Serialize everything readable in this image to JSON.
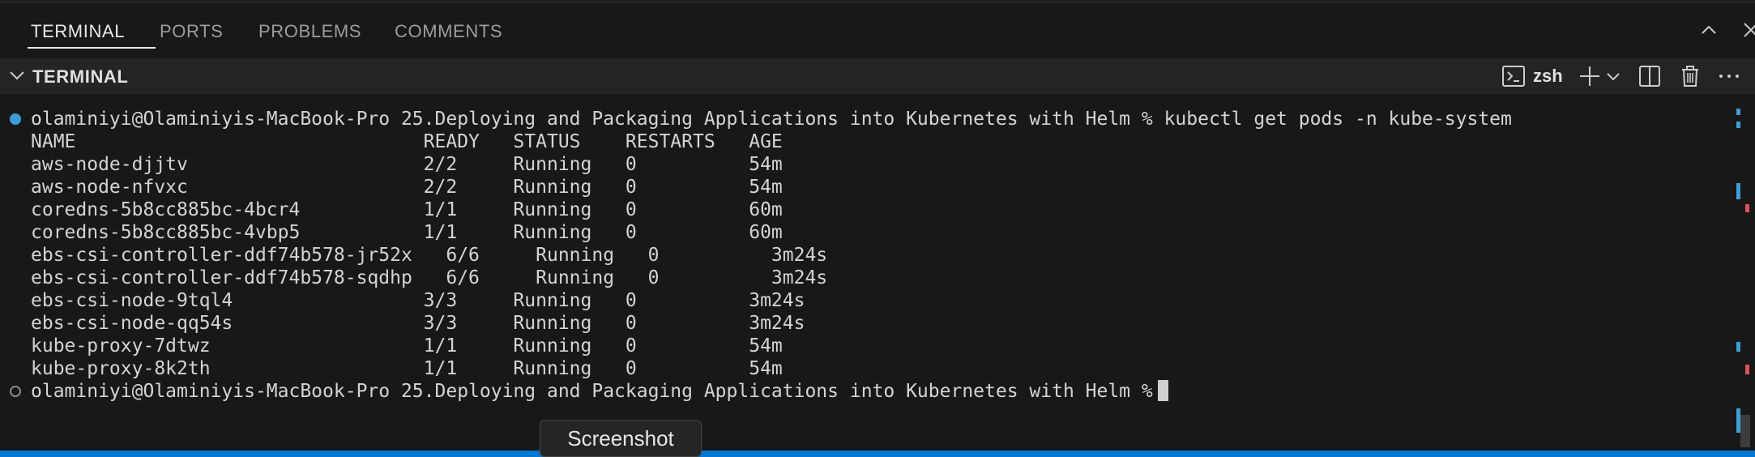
{
  "panel": {
    "tabs": [
      {
        "label": "TERMINAL"
      },
      {
        "label": "PORTS"
      },
      {
        "label": "PROBLEMS"
      },
      {
        "label": "COMMENTS"
      }
    ],
    "active_tab": "TERMINAL",
    "controls": [
      "chevron-up-icon",
      "close-icon"
    ]
  },
  "terminal_header": {
    "title": "TERMINAL",
    "shell": "zsh",
    "icons": [
      "terminal-icon",
      "plus-icon",
      "chevron-down-icon",
      "split-icon",
      "trash-icon",
      "more-icon"
    ]
  },
  "terminal": {
    "command_line": "olaminiyi@Olaminiyis-MacBook-Pro 25.Deploying and Packaging Applications into Kubernetes with Helm % kubectl get pods -n kube-system",
    "lines": [
      "NAME                               READY   STATUS    RESTARTS   AGE",
      "aws-node-djjtv                     2/2     Running   0          54m",
      "aws-node-nfvxc                     2/2     Running   0          54m",
      "coredns-5b8cc885bc-4bcr4           1/1     Running   0          60m",
      "coredns-5b8cc885bc-4vbp5           1/1     Running   0          60m",
      "ebs-csi-controller-ddf74b578-jr52x   6/6     Running   0          3m24s",
      "ebs-csi-controller-ddf74b578-sqdhp   6/6     Running   0          3m24s",
      "ebs-csi-node-9tql4                 3/3     Running   0          3m24s",
      "ebs-csi-node-qq54s                 3/3     Running   0          3m24s",
      "kube-proxy-7dtwz                   1/1     Running   0          54m",
      "kube-proxy-8k2th                   1/1     Running   0          54m"
    ],
    "prompt_line": "olaminiyi@Olaminiyis-MacBook-Pro 25.Deploying and Packaging Applications into Kubernetes with Helm %"
  },
  "tooltip": {
    "label": "Screenshot"
  },
  "colors": {
    "background": "#181818",
    "accent": "#0078d4",
    "decoration_success": "#3a9fd8",
    "marker_error": "#e05252"
  }
}
